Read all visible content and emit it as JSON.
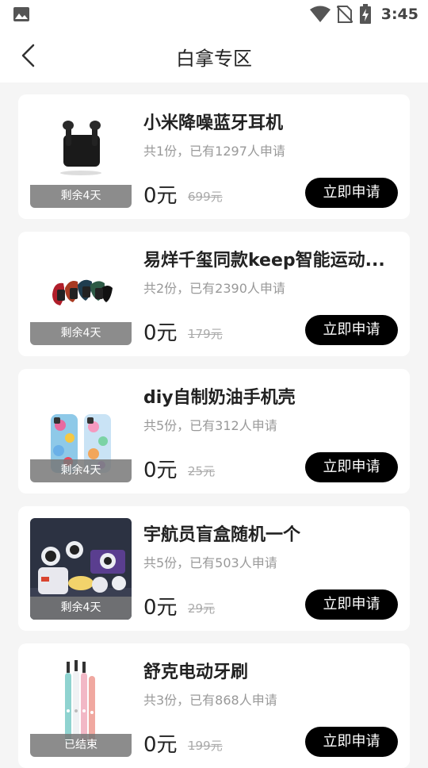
{
  "statusbar": {
    "time": "3:45",
    "icons": [
      "photo-icon",
      "wifi-icon",
      "no-sim-icon",
      "battery-charging-icon"
    ]
  },
  "header": {
    "title": "白拿专区",
    "back_icon": "chevron-left-icon"
  },
  "items": [
    {
      "title": "小米降噪蓝牙耳机",
      "sub": "共1份，已有1297人申请",
      "price": "0元",
      "original_price": "699元",
      "badge": "剩余4天",
      "button": "立即申请",
      "image": "earbuds"
    },
    {
      "title": "易烊千玺同款keep智能运动...",
      "sub": "共2份，已有2390人申请",
      "price": "0元",
      "original_price": "179元",
      "badge": "剩余4天",
      "button": "立即申请",
      "image": "smart-bands"
    },
    {
      "title": "diy自制奶油手机壳",
      "sub": "共5份，已有312人申请",
      "price": "0元",
      "original_price": "25元",
      "badge": "剩余4天",
      "button": "立即申请",
      "image": "phone-cases"
    },
    {
      "title": "宇航员盲盒随机一个",
      "sub": "共5份，已有503人申请",
      "price": "0元",
      "original_price": "29元",
      "badge": "剩余4天",
      "button": "立即申请",
      "image": "astronaut-toys"
    },
    {
      "title": "舒克电动牙刷",
      "sub": "共3份，已有868人申请",
      "price": "0元",
      "original_price": "199元",
      "badge": "已结束",
      "button": "立即申请",
      "image": "toothbrushes"
    }
  ]
}
